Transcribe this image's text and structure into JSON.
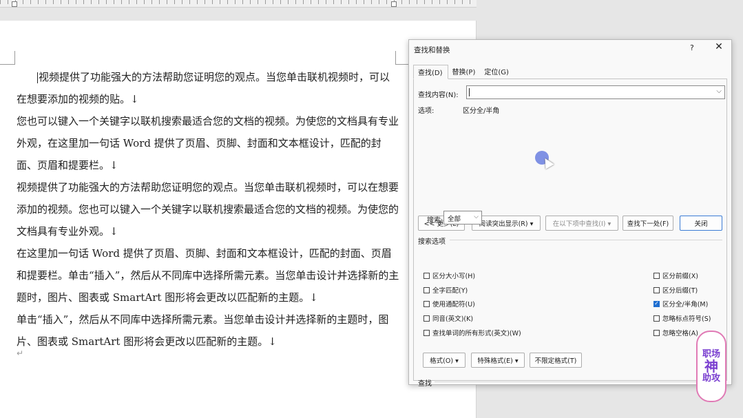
{
  "document": {
    "paragraphs": [
      {
        "text": "视频提供了功能强大的方法帮助您证明您的观点。当您单击联机视频时，可以在想要添加的视频的贴。↓",
        "indent": true
      },
      {
        "text": "您也可以键入一个关键字以联机搜索最适合您的文档的视频。为使您的文档具有专业外观，在这里加一句话 Word 提供了页眉、页脚、封面和文本框设计，匹配的封面、页眉和提要栏。↓",
        "indent": false
      },
      {
        "text": "视频提供了功能强大的方法帮助您证明您的观点。当您单击联机视频时，可以在想要添加的视频。您也可以键入一个关键字以联机搜索最适合您的文档的视频。为使您的文档具有专业外观。↓",
        "indent": false
      },
      {
        "text": "在这里加一句话 Word 提供了页眉、页脚、封面和文本框设计，匹配的封面、页眉和提要栏。单击“插入”，然后从不同库中选择所需元素。当您单击设计并选择新的主题时，图片、图表或 SmartArt 图形将会更改以匹配新的主题。↓",
        "indent": false
      },
      {
        "text": "单击“插入”，然后从不同库中选择所需元素。当您单击设计并选择新的主题时，图片、图表或 SmartArt 图形将会更改以匹配新的主题。↓",
        "indent": false
      }
    ],
    "end_mark": "↵"
  },
  "dialog": {
    "title": "查找和替换",
    "help": "?",
    "close": "✕",
    "tabs": [
      "查找(D)",
      "替换(P)",
      "定位(G)"
    ],
    "find_label": "查找内容(N):",
    "find_value": "",
    "options_label": "选项:",
    "options_value": "区分全/半角",
    "buttons": {
      "less": "<< 更少(L)",
      "reading_highlight": "阅读突出显示(R) ▾",
      "find_in": "在以下项中查找(I) ▾",
      "find_next": "查找下一处(F)",
      "close": "关闭"
    },
    "search_options_label": "搜索选项",
    "search_label": "搜索:",
    "search_value": "全部",
    "checkboxes_left": [
      {
        "label": "区分大小写(H)",
        "checked": false
      },
      {
        "label": "全字匹配(Y)",
        "checked": false
      },
      {
        "label": "使用通配符(U)",
        "checked": false
      },
      {
        "label": "同音(英文)(K)",
        "checked": false
      },
      {
        "label": "查找单词的所有形式(英文)(W)",
        "checked": false
      }
    ],
    "checkboxes_right": [
      {
        "label": "区分前缀(X)",
        "checked": false
      },
      {
        "label": "区分后缀(T)",
        "checked": false
      },
      {
        "label": "区分全/半角(M)",
        "checked": true
      },
      {
        "label": "忽略标点符号(S)",
        "checked": false
      },
      {
        "label": "忽略空格(A)",
        "checked": false
      }
    ],
    "find_section_label": "查找",
    "format_buttons": [
      "格式(O) ▾",
      "特殊格式(E) ▾",
      "不限定格式(T)"
    ]
  },
  "watermark": {
    "line1": "职场",
    "line2": "神",
    "line3": "助攻"
  },
  "colors": {
    "accent": "#1f6fd1",
    "logo_border": "#e07ab5",
    "logo_text": "#7a3fd0"
  }
}
